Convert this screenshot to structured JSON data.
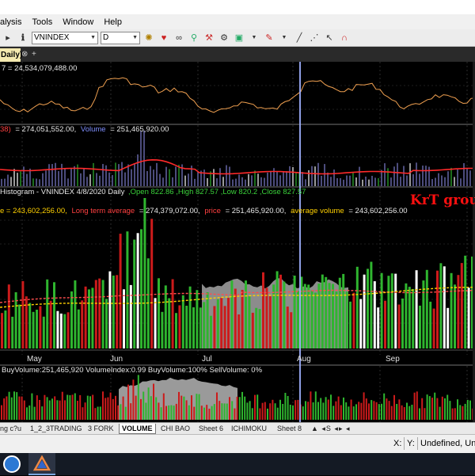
{
  "menu": {
    "items": [
      "alysis",
      "Tools",
      "Window",
      "Help"
    ]
  },
  "toolbar": {
    "symbol": "VNINDEX",
    "period": "D"
  },
  "document_tab": {
    "label": "Daily)",
    "close": "⊗",
    "new": "+"
  },
  "panes": {
    "pane1": {
      "label": "7 = 24,534,079,488.00"
    },
    "pane2": {
      "label_prefix": "38)",
      "label_a": "= 274,051,552.00,",
      "label_vol_name": "Volume",
      "label_b": "= 251,465,920.00"
    },
    "pane3": {
      "title": "Histogram - VNINDEX 4/8/2020 Daily",
      "ohlc": ",Open 822.86 ,High 827.57 ,Low 820.2 ,Close 827.57",
      "line2_a": "e = 243,602,256.00,",
      "line2_b": "Long term average",
      "line2_c": "= 274,379,072.00,",
      "line2_d": "price",
      "line2_e": "= 251,465,920.00,",
      "line2_f": "average volume",
      "line2_g": "= 243,602,256.00",
      "watermark": "KrT group"
    },
    "pane4": {
      "label": "BuyVolume:251,465,920 VolumeIndex:0.99 BuyVolume:100% SellVolume: 0%"
    },
    "months": [
      "May",
      "Jun",
      "Jul",
      "Aug",
      "Sep"
    ]
  },
  "colors": {
    "up": "#2fb52f",
    "down": "#cc1b1b",
    "neutral": "#ffffff",
    "avg_red": "#ff4d4d",
    "avg_yellow": "#ffd000",
    "orange_line": "#f0a050",
    "cursor": "#9fb0ff",
    "area": "#8c8c8c"
  },
  "sheets": [
    "ng c?u",
    "1_2_3TRADING",
    "3 FORK",
    "VOLUME",
    "CHI BAO",
    "Sheet 6",
    "ICHIMOKU",
    "Sheet 8"
  ],
  "sheet_nav": "▲ ◂S ◂▸ ◂",
  "status": {
    "x_label": "X:",
    "y_label": "Y:",
    "value": "Undefined, Unde"
  }
}
